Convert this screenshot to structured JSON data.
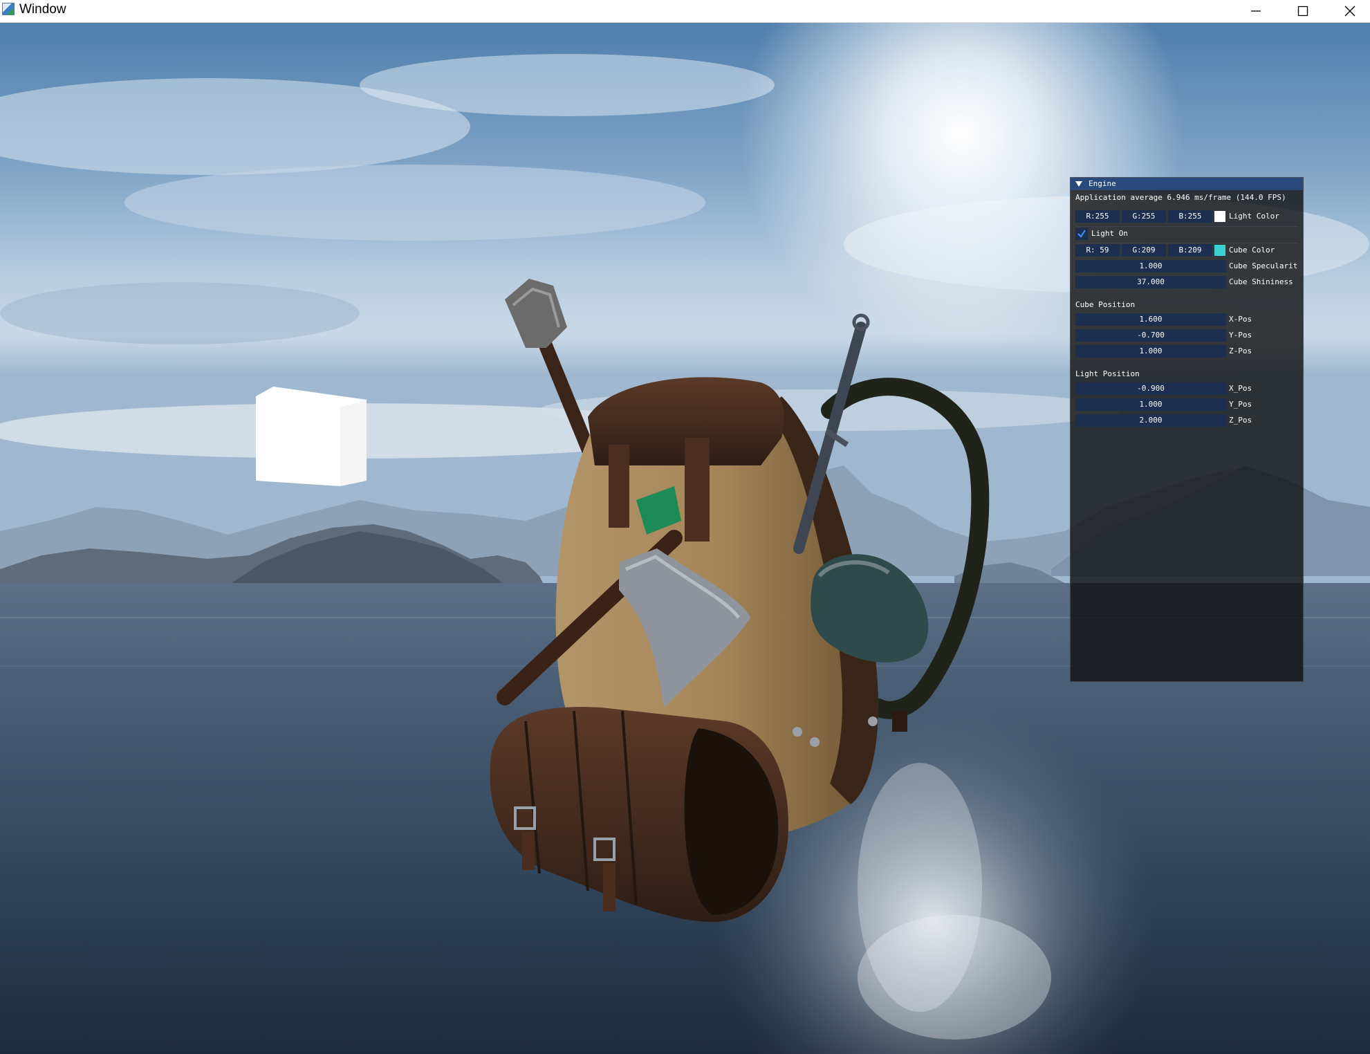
{
  "window": {
    "title": "Window"
  },
  "engine_panel": {
    "title": "Engine",
    "fps_text": "Application average 6.946 ms/frame (144.0 FPS)",
    "light_color": {
      "r": "R:255",
      "g": "G:255",
      "b": "B:255",
      "label": "Light Color",
      "swatch": "#ffffff"
    },
    "light_on": {
      "label": "Light On",
      "checked": true
    },
    "cube_color": {
      "r": "R: 59",
      "g": "G:209",
      "b": "B:209",
      "label": "Cube Color",
      "swatch": "#3bd1d1"
    },
    "cube_specularity": {
      "value": "1.000",
      "label": "Cube Specularit"
    },
    "cube_shininess": {
      "value": "37.000",
      "label": "Cube Shininess"
    },
    "cube_position": {
      "header": "Cube Position",
      "x": {
        "value": "1.600",
        "label": "X-Pos"
      },
      "y": {
        "value": "-0.700",
        "label": "Y-Pos"
      },
      "z": {
        "value": "1.000",
        "label": "Z-Pos"
      }
    },
    "light_position": {
      "header": "Light Position",
      "x": {
        "value": "-0.900",
        "label": "X_Pos"
      },
      "y": {
        "value": "1.000",
        "label": "Y_Pos"
      },
      "z": {
        "value": "2.000",
        "label": "Z_Pos"
      }
    }
  },
  "colors": {
    "imgui_title": "#294a7a",
    "imgui_frame": "#1d2f4e",
    "imgui_check": "#4296fa"
  }
}
